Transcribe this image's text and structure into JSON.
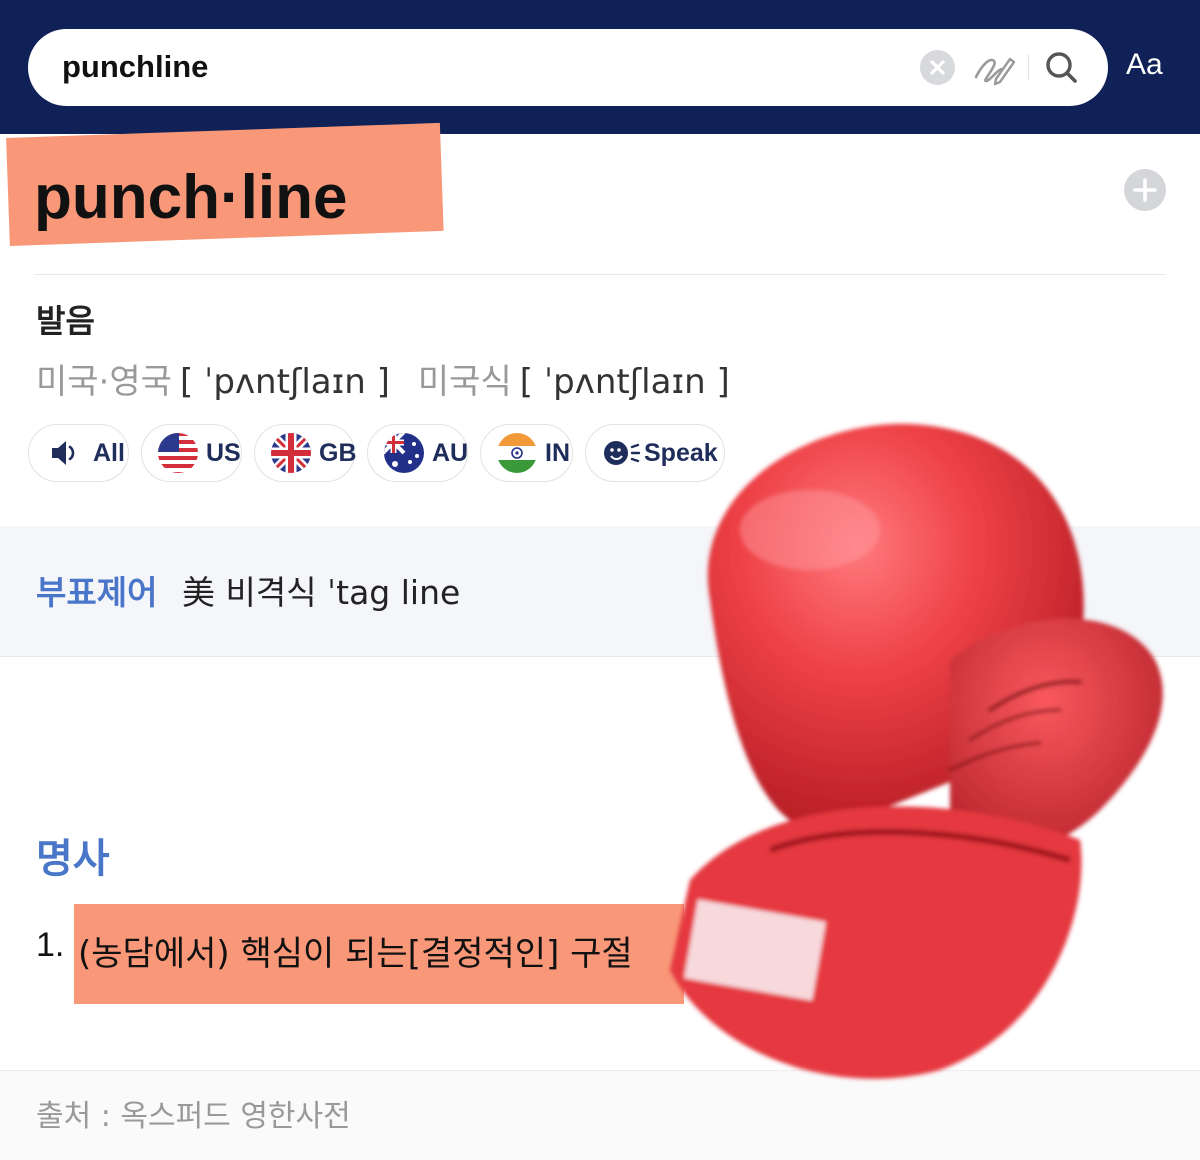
{
  "search": {
    "query": "punchline"
  },
  "header": {
    "font_size_label": "Aa"
  },
  "entry": {
    "headword": "punch·line",
    "pronunciation": {
      "title": "발음",
      "uk_us_label": "미국·영국",
      "uk_us_ipa": "[ ˈpʌntʃlaɪn ]",
      "us_label": "미국식",
      "us_ipa": "[ ˈpʌntʃlaɪn ]"
    },
    "audio_buttons": [
      "All",
      "US",
      "GB",
      "AU",
      "IN",
      "Speak"
    ],
    "variant": {
      "label": "부표제어",
      "text": "美 비격식 ˈtag line"
    },
    "part_of_speech": "명사",
    "definitions": [
      {
        "num": "1.",
        "text": "(농담에서) 핵심이 되는[결정적인] 구절"
      }
    ],
    "source": "출처 : 옥스퍼드 영한사전"
  },
  "colors": {
    "header_bg": "#0f2157",
    "highlight": "#f99878",
    "accent_blue": "#4a76c9",
    "glove_red": "#e53a40"
  },
  "icons": [
    "clear-icon",
    "handwriting-icon",
    "search-icon",
    "plus-icon",
    "speaker-icon",
    "us-flag-icon",
    "gb-flag-icon",
    "au-flag-icon",
    "in-flag-icon",
    "speak-icon",
    "boxing-glove-icon"
  ]
}
